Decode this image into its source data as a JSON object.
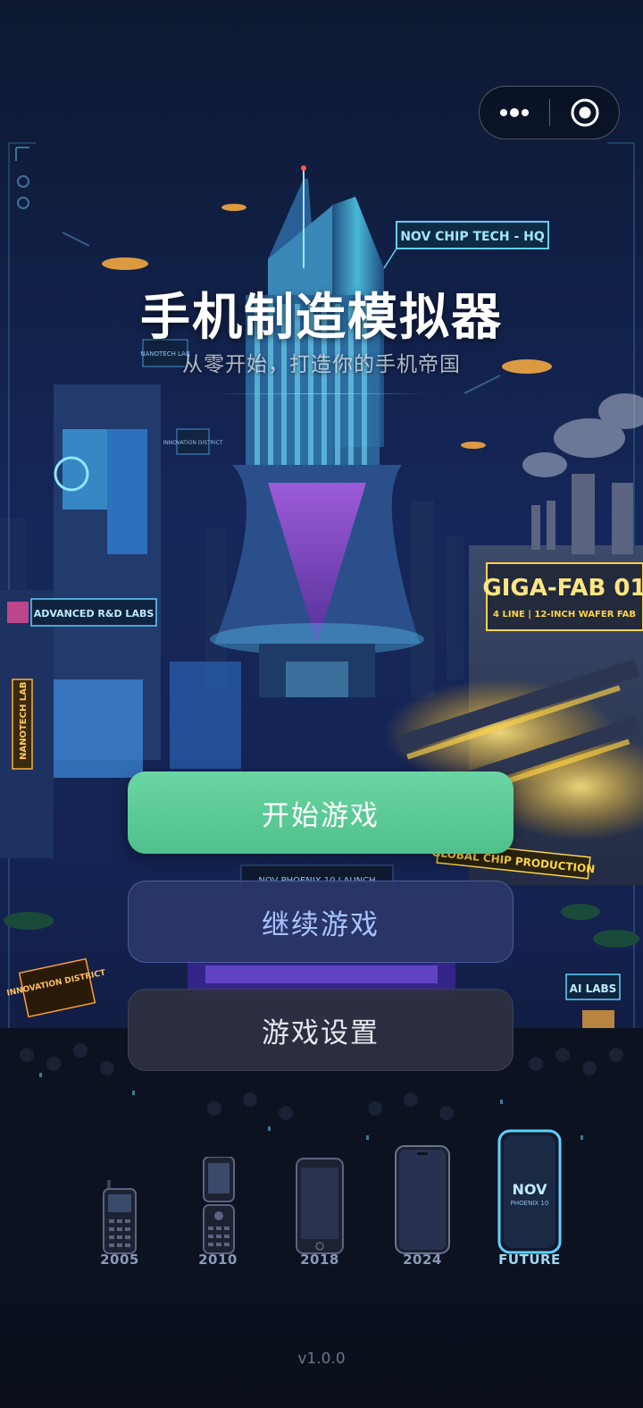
{
  "window": {
    "more_icon": "more-dots-icon",
    "close_icon": "target-close-icon"
  },
  "signs": {
    "hq": "NOV CHIP TECH - HQ",
    "nanotech_top": "NANOTECH LAB",
    "innovation_small": "INNOVATION DISTRICT",
    "advanced_labs": "ADVANCED R&D LABS",
    "nanotech_side": "NANOTECH LAB",
    "innovation_district": "INNOVATION DISTRICT",
    "giga_fab": "GIGA-FAB 01",
    "giga_fab_sub": "4 LINE | 12-INCH WAFER FAB",
    "global_chip": "GLOBAL CHIP PRODUCTION",
    "ai_labs": "AI LABS",
    "launch": "NOV PHOENIX 10 LAUNCH"
  },
  "main": {
    "title": "手机制造模拟器",
    "subtitle": "从零开始，打造你的手机帝国"
  },
  "buttons": {
    "start": "开始游戏",
    "continue": "继续游戏",
    "settings": "游戏设置"
  },
  "timeline": {
    "years": [
      "2005",
      "2010",
      "2018",
      "2024",
      "FUTURE"
    ],
    "future_phone_brand": "NOV",
    "future_phone_model": "PHOENIX 10"
  },
  "footer": {
    "version": "v1.0.0"
  },
  "colors": {
    "start_button": "#5cc897",
    "continue_button": "#2a3668",
    "settings_button": "#2e3042",
    "accent_cyan": "#5fd0ff",
    "neon_yellow": "#ffd447"
  }
}
